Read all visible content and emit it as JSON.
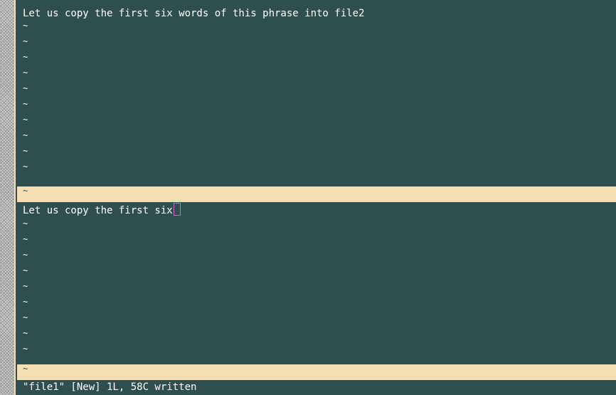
{
  "top_window": {
    "text_line": "Let us copy the first six words of this phrase into file2",
    "tilde": "~"
  },
  "bottom_window": {
    "text_line": "Let us copy the first six",
    "tilde": "~"
  },
  "status_tilde": "~",
  "command_line": "\"file1\" [New] 1L, 58C written",
  "colors": {
    "background": "#2f4f4f",
    "status_bar": "#f5deb3",
    "cursor": "#cc66cc",
    "text": "#ffffff"
  }
}
